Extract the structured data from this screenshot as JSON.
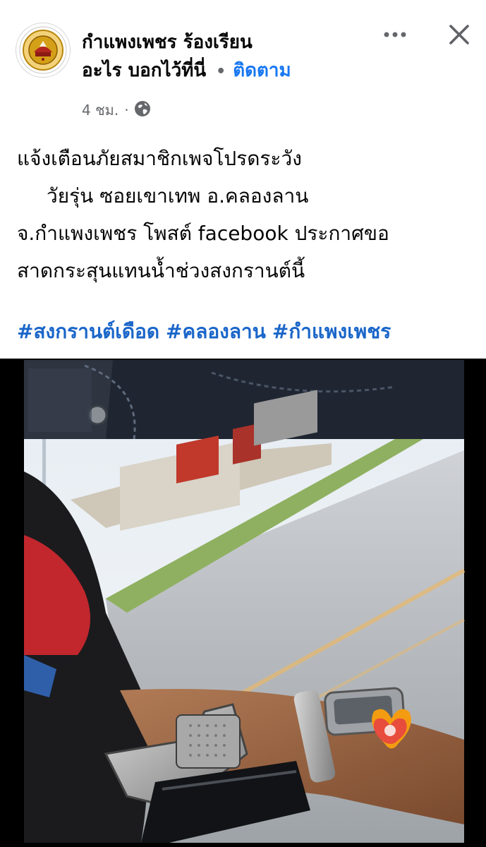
{
  "post": {
    "page_name_line1": "กำแพงเพชร ร้องเรียน",
    "page_name_line2": "อะไร บอกไว้ที่นี่",
    "separator": "•",
    "follow_label": "ติดตาม",
    "time": "4 ชม.",
    "meta_separator": "·",
    "privacy_icon": "globe-icon",
    "more_icon": "more-dots-icon",
    "close_icon": "close-icon",
    "caption": {
      "line1": "แจ้งเตือนภัยสมาชิกเพจโปรดระวัง",
      "line2": "วัยรุ่น ซอยเขาเทพ อ.คลองลาน",
      "line3": "จ.กำแพงเพชร โพสต์ facebook ประกาศขอ",
      "line4": "สาดกระสุนแทนน้ำช่วงสงกรานต์นี้"
    },
    "hashtags": [
      "#สงกรานต์เดือด",
      "#คลองลาน",
      "#กำแพงเพชร"
    ]
  },
  "colors": {
    "link_blue": "#1a66c9",
    "follow_blue": "#1877f2",
    "meta_gray": "#65676b",
    "logo_gold": "#d4a017",
    "logo_red": "#b3261e"
  },
  "media": {
    "image_subject": "photo-of-person-holding-handgun-with-watch-by-roadside"
  }
}
